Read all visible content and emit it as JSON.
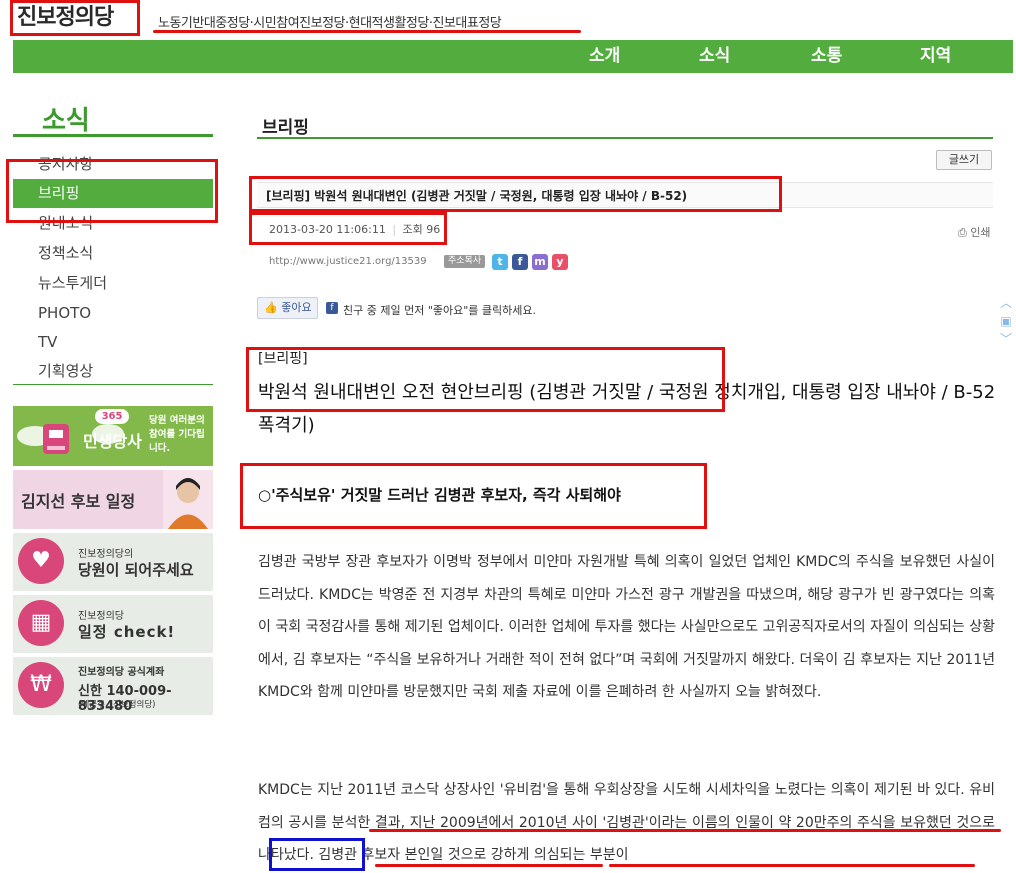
{
  "header": {
    "logo_text": "진보정의당",
    "tagline": "노동기반대중정당·시민참여진보정당·현대적생활정당·진보대표정당"
  },
  "nav": {
    "items": [
      "소개",
      "소식",
      "소통",
      "지역"
    ]
  },
  "sidebar": {
    "title": "소식",
    "items": [
      "공지사항",
      "브리핑",
      "원내소식",
      "정책소식",
      "뉴스투게더",
      "PHOTO",
      "TV",
      "기획영상"
    ]
  },
  "banners": {
    "b1": {
      "badge": "365",
      "title": "민생당사",
      "text": "당원 여러분의 참여를 기다립니다."
    },
    "b2": {
      "title": "김지선 후보 일정"
    },
    "b3": {
      "small": "진보정의당의",
      "large": "당원이 되어주세요"
    },
    "b4": {
      "small": "진보정의당",
      "large": "일정 check!"
    },
    "b5": {
      "small": "진보정의당 공식계좌",
      "large": "신한 140-009-833480",
      "note": "(예금주 : 진보정의당)"
    }
  },
  "content": {
    "section_title": "브리핑",
    "write_button": "글쓰기",
    "post_title": "[브리핑] 박원석 원내대변인 (김병관 거짓말 / 국정원, 대통령 입장 내놔야 / B-52)",
    "date": "2013-03-20 11:06:11",
    "views": "조회 96",
    "print_label": "인쇄",
    "url": "http://www.justice21.org/13539",
    "copy_label": "주소복사",
    "like_label": "좋아요",
    "like_text": "친구 중 제일 먼저 \"좋아요\"를 클릭하세요.",
    "bracket": "[브리핑]",
    "headline": "박원석 원내대변인 오전 현안브리핑 (김병관 거짓말 / 국정원 정치개입, 대통령 입장 내놔야 / B-52 폭격기)",
    "sub_head": "○'주식보유' 거짓말 드러난 김병관 후보자, 즉각 사퇴해야",
    "para1": "김병관 국방부 장관 후보자가 이명박 정부에서 미얀마 자원개발 특혜 의혹이 일었던 업체인 KMDC의 주식을 보유했던 사실이 드러났다. KMDC는 박영준 전 지경부 차관의 특혜로 미얀마 가스전 광구 개발권을 따냈으며, 해당 광구가 빈 광구였다는 의혹이 국회 국정감사를 통해 제기된 업체이다. 이러한 업체에 투자를 했다는 사실만으로도 고위공직자로서의 자질이 의심되는 상황에서, 김 후보자는 “주식을 보유하거나 거래한 적이 전혀 없다”며 국회에 거짓말까지 해왔다. 더욱이 김 후보자는 지난 2011년 KMDC와 함께 미얀마를 방문했지만 국회 제출 자료에 이를 은폐하려 한 사실까지 오늘 밝혀졌다.",
    "para2": "KMDC는 지난 2011년 코스닥 상장사인 '유비컴'을 통해 우회상장을 시도해 시세차익을 노렸다는 의혹이 제기된 바 있다. 유비컴의 공시를 분석한 결과, 지난 2009년에서 2010년 사이 '김병관'이라는 이름의 인물이 약 20만주의 주식을 보유했던 것으로 나타났다. 김병관 후보자 본인일 것으로 강하게 의심되는 부분이"
  }
}
